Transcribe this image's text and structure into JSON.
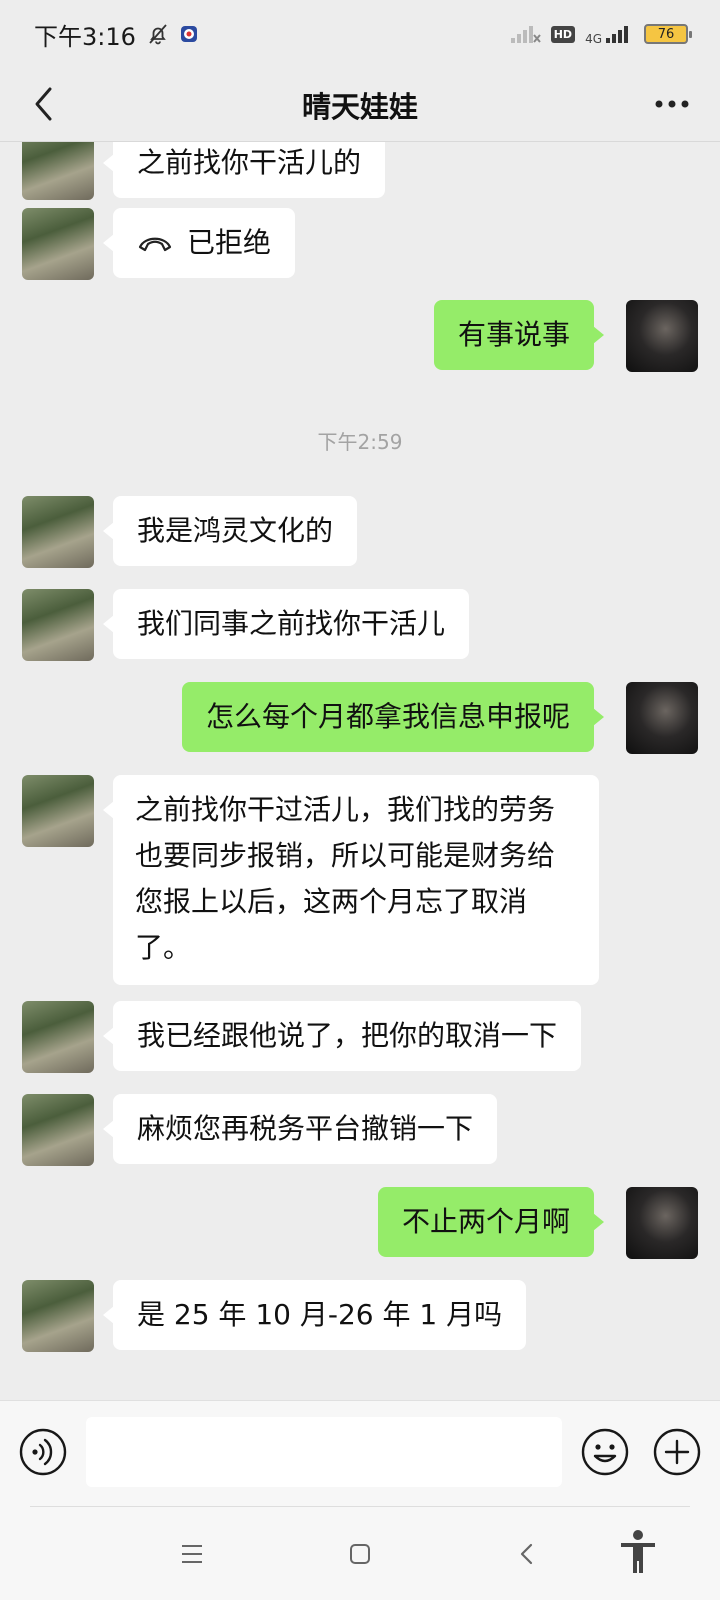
{
  "status_bar": {
    "time": "下午3:16",
    "network": "4G",
    "hd": "HD",
    "battery": "76"
  },
  "header": {
    "title": "晴天娃娃"
  },
  "messages": [
    {
      "side": "in",
      "text": "之前找你干活儿的"
    },
    {
      "side": "in",
      "call_text": "已拒绝"
    },
    {
      "side": "out",
      "text": "有事说事"
    },
    {
      "timestamp": "下午2:59"
    },
    {
      "side": "in",
      "text": "我是鸿灵文化的"
    },
    {
      "side": "in",
      "text": "我们同事之前找你干活儿"
    },
    {
      "side": "out",
      "text": "怎么每个月都拿我信息申报呢"
    },
    {
      "side": "in",
      "lines": [
        "之前找你干过活儿，我们找的劳务",
        "也要同步报销，所以可能是财务给",
        "您报上以后，这两个月忘了取消",
        "了。"
      ]
    },
    {
      "side": "in",
      "text": "我已经跟他说了，把你的取消一下"
    },
    {
      "side": "in",
      "text": "麻烦您再税务平台撤销一下"
    },
    {
      "side": "out",
      "text": "不止两个月啊"
    },
    {
      "side": "in",
      "text": "是 25 年 10 月-26 年 1 月吗"
    }
  ],
  "input": {
    "value": "",
    "placeholder": ""
  },
  "icons": {
    "back": "chevron-left-icon",
    "more": "more-dots-icon",
    "voice": "voice-icon",
    "emoji": "emoji-icon",
    "plus": "plus-icon",
    "call": "phone-hangup-icon"
  },
  "colors": {
    "background": "#ededed",
    "incoming_bubble": "#ffffff",
    "outgoing_bubble": "#95ec69",
    "timestamp": "#a3a3a3"
  }
}
